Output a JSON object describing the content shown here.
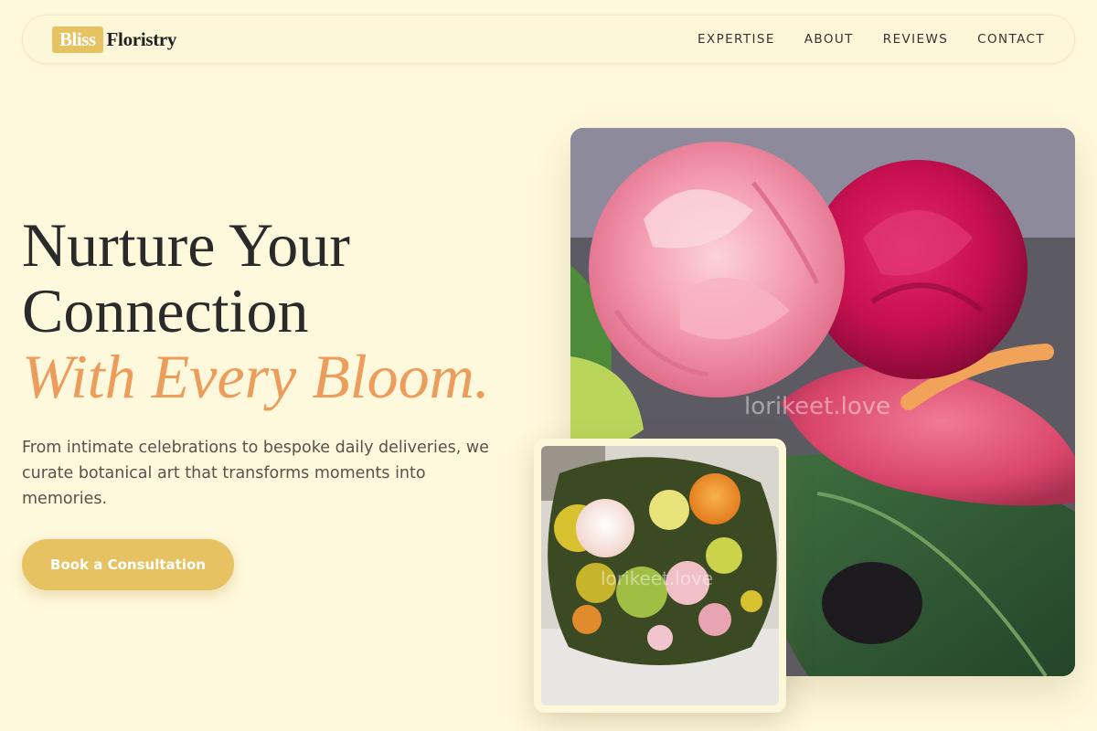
{
  "brand": {
    "badge": "Bliss",
    "name": "Floristry"
  },
  "nav": {
    "links": [
      "EXPERTISE",
      "ABOUT",
      "REVIEWS",
      "CONTACT"
    ]
  },
  "hero": {
    "headline_line1": "Nurture Your",
    "headline_line2": "Connection",
    "headline_accent": "With Every Bloom.",
    "subtext": "From intimate celebrations to bespoke daily deliveries, we curate botanical art that transforms moments into memories.",
    "cta_label": "Book a Consultation"
  },
  "images": {
    "main": {
      "subject": "pink peony, magenta rose and pink anthurium bouquet",
      "watermark": "lorikeet.love"
    },
    "secondary": {
      "subject": "mixed bouquet of ranunculus, yellow flowers and mimosa",
      "watermark": "lorikeet.love"
    }
  },
  "colors": {
    "background": "#fef8dc",
    "accent_gold": "#e6c263",
    "accent_orange": "#ec9d5c",
    "text_dark": "#2a2a2a"
  }
}
